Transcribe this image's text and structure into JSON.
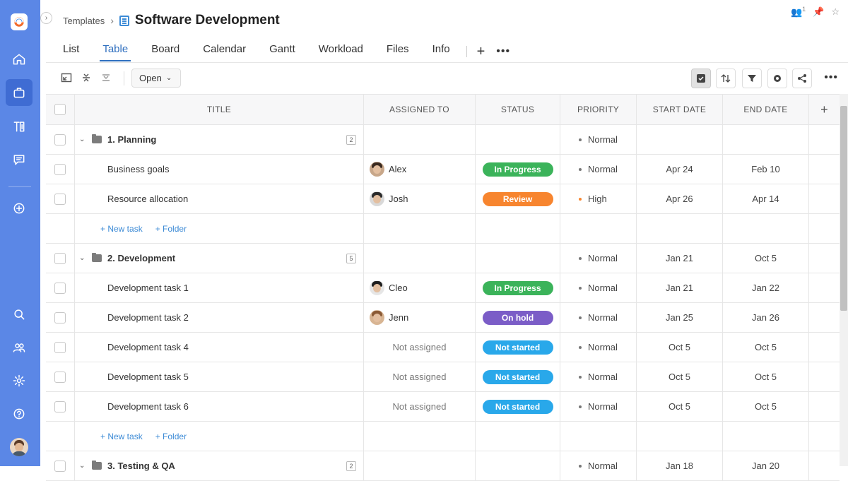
{
  "rail": {
    "items": [
      {
        "name": "home-icon"
      },
      {
        "name": "briefcase-icon"
      },
      {
        "name": "templates-icon"
      },
      {
        "name": "chat-icon"
      },
      {
        "name": "plus-circle-icon"
      },
      {
        "name": "search-icon"
      },
      {
        "name": "users-icon"
      },
      {
        "name": "gear-icon"
      },
      {
        "name": "help-icon"
      }
    ]
  },
  "breadcrumb": {
    "parent": "Templates",
    "title": "Software Development"
  },
  "top_right": {
    "members_count": "1"
  },
  "tabs": [
    "List",
    "Table",
    "Board",
    "Calendar",
    "Gantt",
    "Workload",
    "Files",
    "Info"
  ],
  "active_tab": "Table",
  "toolbar": {
    "filter_select": "Open"
  },
  "columns": {
    "title": "TITLE",
    "assigned": "ASSIGNED TO",
    "status": "STATUS",
    "priority": "PRIORITY",
    "start": "START DATE",
    "end": "END DATE"
  },
  "links": {
    "new_task": "+ New task",
    "folder": "+ Folder"
  },
  "groups": [
    {
      "title": "1. Planning",
      "count": "2",
      "priority": "Normal",
      "start": "",
      "end": "",
      "tasks": [
        {
          "title": "Business goals",
          "assignee": "Alex",
          "status": "In Progress",
          "priority": "Normal",
          "start": "Apr 24",
          "end": "Feb 10"
        },
        {
          "title": "Resource allocation",
          "assignee": "Josh",
          "status": "Review",
          "priority": "High",
          "start": "Apr 26",
          "end": "Apr 14"
        }
      ]
    },
    {
      "title": "2. Development",
      "count": "5",
      "priority": "Normal",
      "start": "Jan 21",
      "end": "Oct 5",
      "tasks": [
        {
          "title": "Development task 1",
          "assignee": "Cleo",
          "status": "In Progress",
          "priority": "Normal",
          "start": "Jan 21",
          "end": "Jan 22"
        },
        {
          "title": "Development task 2",
          "assignee": "Jenn",
          "status": "On hold",
          "priority": "Normal",
          "start": "Jan 25",
          "end": "Jan 26"
        },
        {
          "title": "Development task 4",
          "assignee": "Not assigned",
          "status": "Not started",
          "priority": "Normal",
          "start": "Oct 5",
          "end": "Oct 5"
        },
        {
          "title": "Development task 5",
          "assignee": "Not assigned",
          "status": "Not started",
          "priority": "Normal",
          "start": "Oct 5",
          "end": "Oct 5"
        },
        {
          "title": "Development task 6",
          "assignee": "Not assigned",
          "status": "Not started",
          "priority": "Normal",
          "start": "Oct 5",
          "end": "Oct 5"
        }
      ]
    },
    {
      "title": "3. Testing & QA",
      "count": "2",
      "priority": "Normal",
      "start": "Jan 18",
      "end": "Jan 20",
      "tasks": []
    }
  ],
  "status_colors": {
    "In Progress": "#3bb35a",
    "Review": "#f7852f",
    "On hold": "#7b5dc7",
    "Not started": "#29a8ea"
  },
  "priority_colors": {
    "Normal": "#777777",
    "High": "#f7852f"
  },
  "avatar_colors": {
    "Alex": {
      "hair": "#3a2a20",
      "bg": "#c8a78a"
    },
    "Josh": {
      "hair": "#2b2b2b",
      "bg": "#d9d9d9"
    },
    "Cleo": {
      "hair": "#1e1e1e",
      "bg": "#e6e6e6"
    },
    "Jenn": {
      "hair": "#8a5a35",
      "bg": "#d8b593"
    }
  }
}
